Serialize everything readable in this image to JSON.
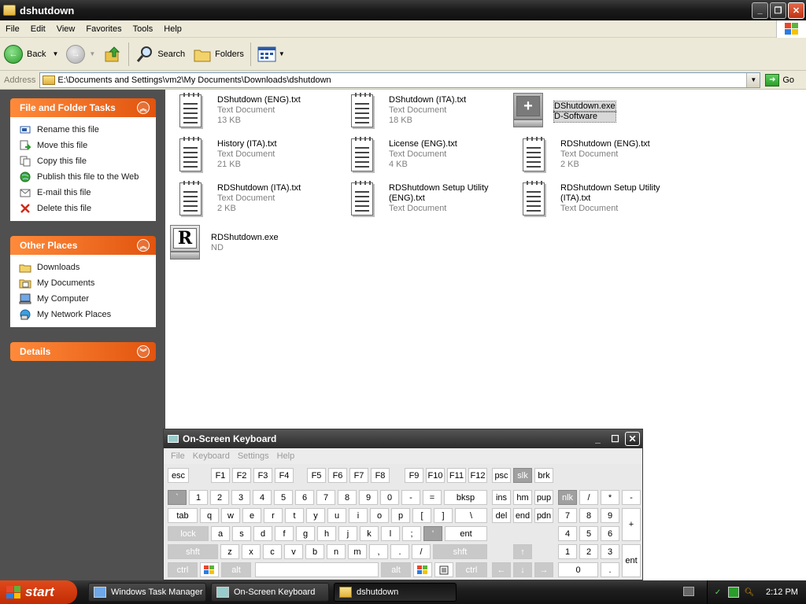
{
  "window": {
    "title": "dshutdown"
  },
  "menu": [
    "File",
    "Edit",
    "View",
    "Favorites",
    "Tools",
    "Help"
  ],
  "toolbar": {
    "back": "Back",
    "search": "Search",
    "folders": "Folders"
  },
  "address": {
    "label": "Address",
    "path": "E:\\Documents and Settings\\vm2\\My Documents\\Downloads\\dshutdown",
    "go": "Go"
  },
  "tasks": {
    "title": "File and Folder Tasks",
    "items": [
      "Rename this file",
      "Move this file",
      "Copy this file",
      "Publish this file to the Web",
      "E-mail this file",
      "Delete this file"
    ]
  },
  "places": {
    "title": "Other Places",
    "items": [
      "Downloads",
      "My Documents",
      "My Computer",
      "My Network Places"
    ]
  },
  "details": {
    "title": "Details"
  },
  "files": [
    {
      "name": "DShutdown (ENG).txt",
      "type": "Text Document",
      "size": "13 KB",
      "icon": "text-document"
    },
    {
      "name": "DShutdown (ITA).txt",
      "type": "Text Document",
      "size": "18 KB",
      "icon": "text-document"
    },
    {
      "name": "DShutdown.exe",
      "type": "D-Software",
      "size": "",
      "icon": "dshutdown-exe",
      "selected": true
    },
    {
      "name": "History (ITA).txt",
      "type": "Text Document",
      "size": "21 KB",
      "icon": "text-document"
    },
    {
      "name": "License (ENG).txt",
      "type": "Text Document",
      "size": "4 KB",
      "icon": "text-document"
    },
    {
      "name": "RDShutdown (ENG).txt",
      "type": "Text Document",
      "size": "2 KB",
      "icon": "text-document"
    },
    {
      "name": "RDShutdown (ITA).txt",
      "type": "Text Document",
      "size": "2 KB",
      "icon": "text-document"
    },
    {
      "name": "RDShutdown Setup Utility (ENG).txt",
      "type": "Text Document",
      "size": "",
      "icon": "text-document"
    },
    {
      "name": "RDShutdown Setup Utility (ITA).txt",
      "type": "Text Document",
      "size": "",
      "icon": "text-document"
    },
    {
      "name": "RDShutdown.exe",
      "type": "ND",
      "size": "",
      "icon": "rdshutdown-exe"
    }
  ],
  "osk": {
    "title": "On-Screen Keyboard",
    "menu": [
      "File",
      "Keyboard",
      "Settings",
      "Help"
    ]
  },
  "keys": {
    "esc": "esc",
    "F1": "F1",
    "F2": "F2",
    "F3": "F3",
    "F4": "F4",
    "F5": "F5",
    "F6": "F6",
    "F7": "F7",
    "F8": "F8",
    "F9": "F9",
    "F10": "F10",
    "F11": "F11",
    "F12": "F12",
    "psc": "psc",
    "slk": "slk",
    "brk": "brk",
    "grave": "`",
    "n1": "1",
    "n2": "2",
    "n3": "3",
    "n4": "4",
    "n5": "5",
    "n6": "6",
    "n7": "7",
    "n8": "8",
    "n9": "9",
    "n0": "0",
    "minus": "-",
    "equals": "=",
    "bksp": "bksp",
    "ins": "ins",
    "hm": "hm",
    "pup": "pup",
    "nlk": "nlk",
    "kslash": "/",
    "kstar": "*",
    "kminus": "-",
    "tab": "tab",
    "q": "q",
    "w": "w",
    "e": "e",
    "r": "r",
    "t": "t",
    "y": "y",
    "u": "u",
    "i": "i",
    "o": "o",
    "p": "p",
    "lbr": "[",
    "rbr": "]",
    "bslash": "\\",
    "del": "del",
    "end": "end",
    "pdn": "pdn",
    "k7": "7",
    "k8": "8",
    "k9": "9",
    "kplus": "+",
    "lock": "lock",
    "a": "a",
    "s": "s",
    "d": "d",
    "f": "f",
    "g": "g",
    "h": "h",
    "j": "j",
    "k": "k",
    "l": "l",
    "semi": ";",
    "quote": "'",
    "ent": "ent",
    "k4": "4",
    "k5": "5",
    "k6": "6",
    "lshft": "shft",
    "z": "z",
    "x": "x",
    "c": "c",
    "v": "v",
    "b": "b",
    "n": "n",
    "m": "m",
    "comma": ",",
    "period": ".",
    "slash": "/",
    "rshft": "shft",
    "up": "↑",
    "k1": "1",
    "k2": "2",
    "k3": "3",
    "kent": "ent",
    "lctrl": "ctrl",
    "lalt": "alt",
    "space": "",
    "ralt": "alt",
    "rctrl": "ctrl",
    "left": "←",
    "down": "↓",
    "right": "→",
    "k0": "0",
    "kdot": "."
  },
  "taskbar": {
    "start": "start",
    "buttons": [
      "Windows Task Manager",
      "On-Screen Keyboard",
      "dshutdown"
    ],
    "clock": "2:12 PM"
  }
}
